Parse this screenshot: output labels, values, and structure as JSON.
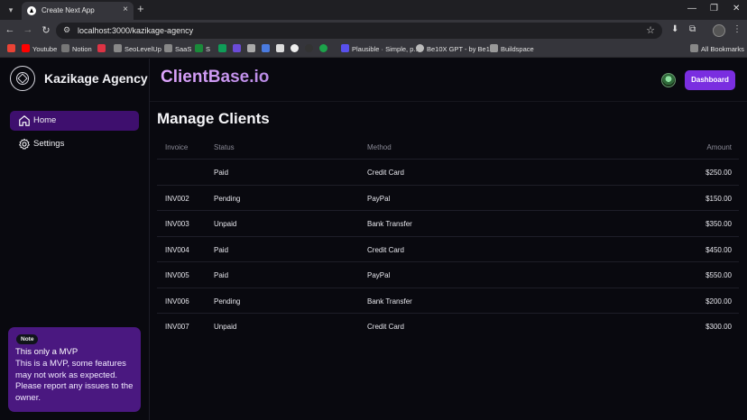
{
  "browser": {
    "tab_title": "Create Next App",
    "url": "localhost:3000/kazikage-agency",
    "bookmarks": [
      "Youtube",
      "Notion",
      "SeoLevelUp",
      "SaaS",
      "S",
      "Plausible · Simple, p...",
      "Be10X GPT - by Be1...",
      "Buildspace"
    ],
    "all_bookmarks": "All Bookmarks"
  },
  "sidebar": {
    "brand": "Kazikage Agency",
    "items": [
      {
        "label": "Home",
        "icon": "home-icon"
      },
      {
        "label": "Settings",
        "icon": "gear-icon"
      }
    ],
    "note": {
      "badge": "Note",
      "title": "This only a MVP",
      "body": "This is a MVP, some features may not work as expected. Please report any issues to the owner."
    }
  },
  "header": {
    "logo": "ClientBase.io",
    "button": "Dashboard"
  },
  "main": {
    "title": "Manage Clients",
    "columns": [
      "Invoice",
      "Status",
      "Method",
      "Amount"
    ],
    "rows": [
      {
        "invoice": "",
        "status": "Paid",
        "method": "Credit Card",
        "amount": "$250.00"
      },
      {
        "invoice": "INV002",
        "status": "Pending",
        "method": "PayPal",
        "amount": "$150.00"
      },
      {
        "invoice": "INV003",
        "status": "Unpaid",
        "method": "Bank Transfer",
        "amount": "$350.00"
      },
      {
        "invoice": "INV004",
        "status": "Paid",
        "method": "Credit Card",
        "amount": "$450.00"
      },
      {
        "invoice": "INV005",
        "status": "Paid",
        "method": "PayPal",
        "amount": "$550.00"
      },
      {
        "invoice": "INV006",
        "status": "Pending",
        "method": "Bank Transfer",
        "amount": "$200.00"
      },
      {
        "invoice": "INV007",
        "status": "Unpaid",
        "method": "Credit Card",
        "amount": "$300.00"
      }
    ]
  },
  "colors": {
    "accent": "#7a2ee0",
    "active_nav": "#3e0f6e",
    "note_bg": "#4a1880"
  }
}
